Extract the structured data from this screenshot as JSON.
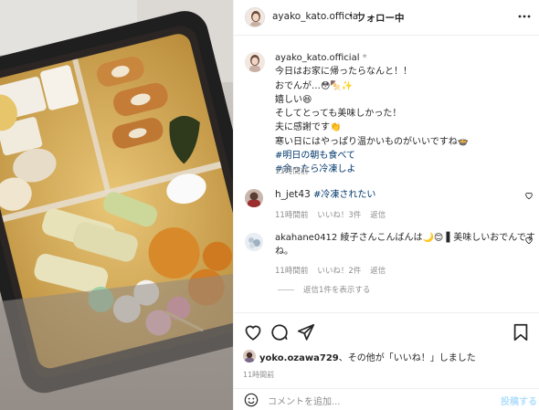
{
  "header": {
    "username": "ayako_kato.official",
    "separator": "•",
    "follow_label": "フォロー中",
    "more_label": "•••"
  },
  "caption": {
    "username": "ayako_kato.official",
    "verified_mark": "*",
    "lines": [
      "今日はお家に帰ったらなんと！！",
      "おでんが…😳🍢✨",
      "嬉しい😆",
      "そしてとっても美味しかった！",
      "夫に感謝です👏",
      "寒い日にはやっぱり温かいものがいいですね🍲"
    ],
    "hashtags": [
      "#明日の朝も食べて",
      "#余ったら冷凍しよ"
    ],
    "time": "11時間前"
  },
  "comments": [
    {
      "username": "h_jet43",
      "text": "#冷凍されたい",
      "time": "11時間前",
      "likes": "いいね！3件",
      "reply_label": "返信"
    },
    {
      "username": "akahane0412",
      "text_line1": "綾子さんこんばんは🌙😊 ▌美味しいおでんです",
      "text_line2": "ね。",
      "time": "11時間前",
      "likes": "いいね！2件",
      "reply_label": "返信",
      "view_replies": "返信1件を表示する"
    }
  ],
  "footer": {
    "liked_by_user": "yoko.ozawa729",
    "liked_by_suffix": "、その他が「いいね！」しました",
    "time": "11時間前",
    "comment_placeholder": "コメントを追加...",
    "post_label": "投稿する"
  },
  "icons": {
    "more": "ellipsis-icon",
    "like": "heart-icon",
    "comment": "comment-icon",
    "share": "paper-plane-icon",
    "save": "bookmark-icon",
    "emoji": "smiley-icon"
  },
  "colors": {
    "hashtag": "#00376b",
    "muted": "#8e8e8e",
    "post_disabled": "#b2dffc"
  }
}
